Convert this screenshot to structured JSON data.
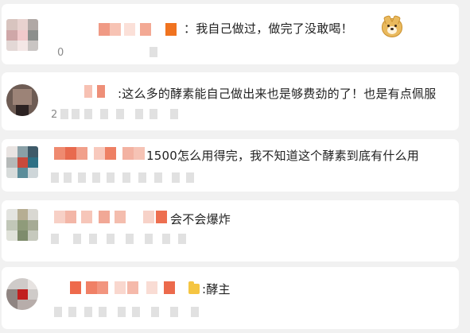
{
  "comments": [
    {
      "text": "：我自己做过，做完了没敢喝！",
      "meta": "0",
      "emoji": "doge-icon"
    },
    {
      "text": ":这么多的酵素能自己做出来也是够费劲的了！也是有点佩服",
      "meta": "2"
    },
    {
      "text": "1500怎么用得完，我不知道这个酵素到底有什么用",
      "meta": ""
    },
    {
      "text": "会不会爆炸",
      "meta": ""
    },
    {
      "text": ":酵主",
      "meta": "",
      "emoji": "folder-icon"
    }
  ],
  "colors": {
    "background": "#f1f1f1",
    "card": "#ffffff",
    "text": "#222222",
    "meta": "#9a9a9a",
    "mosaic_accent": "#ee7b5a"
  }
}
